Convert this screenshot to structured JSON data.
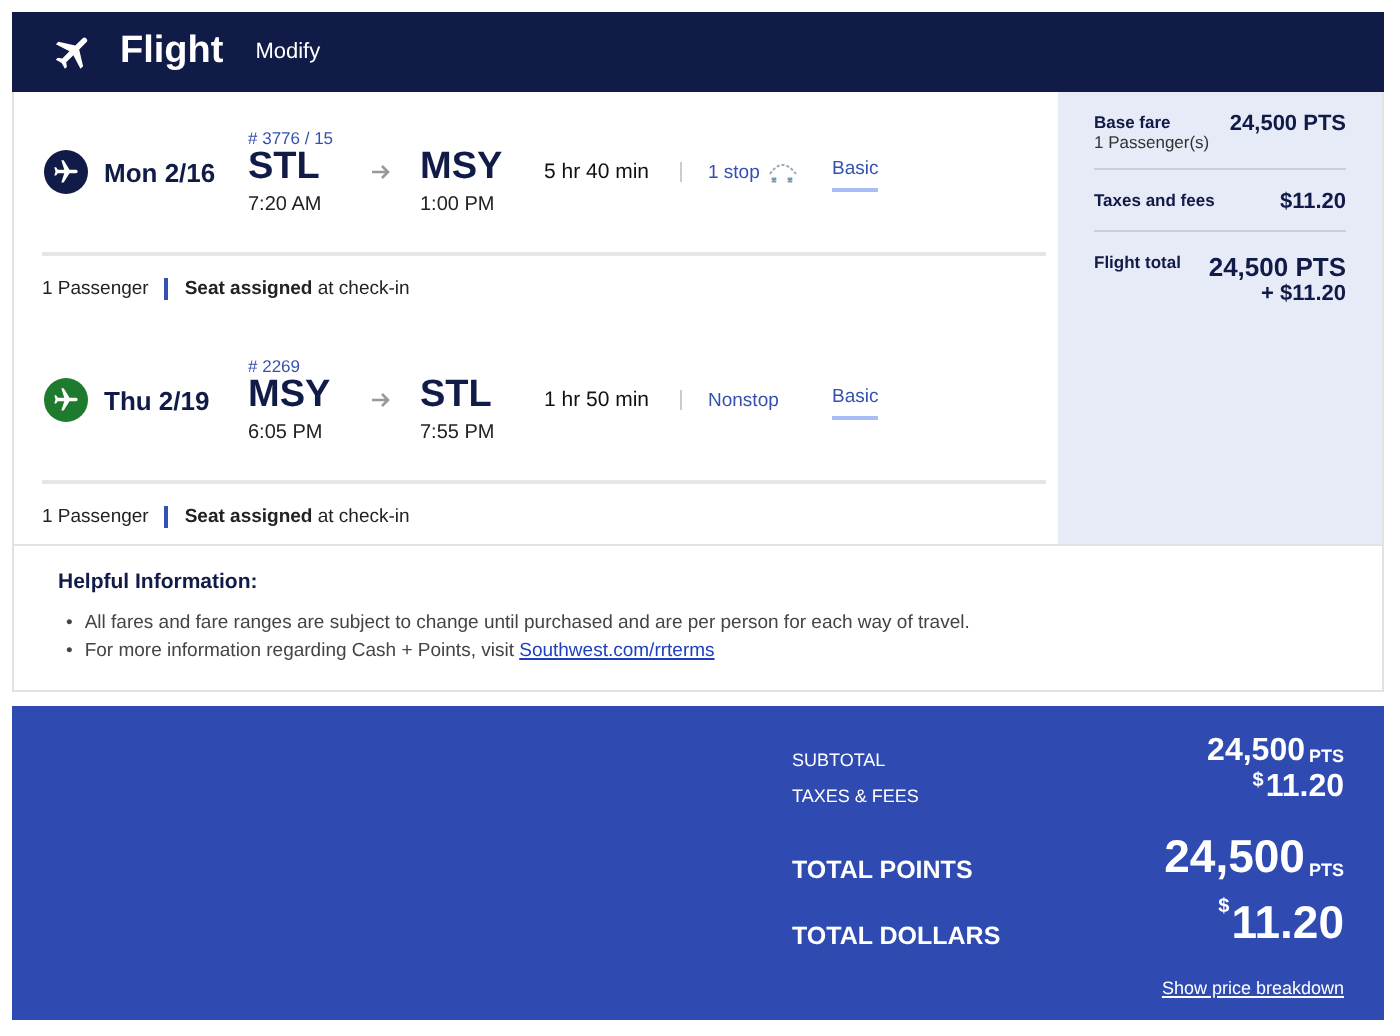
{
  "header": {
    "title": "Flight",
    "action": "Modify"
  },
  "flights": [
    {
      "color": "#111b47",
      "date": "Mon 2/16",
      "number": "# 3776 / 15",
      "from": "STL",
      "depart": "7:20 AM",
      "to": "MSY",
      "arrive": "1:00 PM",
      "duration": "5 hr 40 min",
      "kind": "connecting",
      "stops": "1 stop",
      "fare": "Basic",
      "passengers": "1 Passenger",
      "seat_bold": "Seat assigned",
      "seat_rest": "at check-in"
    },
    {
      "color": "#1e7a2c",
      "date": "Thu 2/19",
      "number": "# 2269",
      "from": "MSY",
      "depart": "6:05 PM",
      "to": "STL",
      "arrive": "7:55 PM",
      "duration": "1 hr 50 min",
      "kind": "nonstop",
      "stops": "Nonstop",
      "fare": "Basic",
      "passengers": "1 Passenger",
      "seat_bold": "Seat assigned",
      "seat_rest": "at check-in"
    }
  ],
  "summary": [
    {
      "label": "Base fare",
      "sub": "1 Passenger(s)",
      "value": "24,500 PTS"
    },
    {
      "label": "Taxes and fees",
      "value": "$11.20"
    },
    {
      "label": "Flight total",
      "value": "24,500 PTS",
      "extra": "+ $11.20"
    }
  ],
  "info": {
    "title": "Helpful Information:",
    "items": [
      {
        "marker": "•",
        "text": "All fares and fare ranges are subject to change until purchased and are per person for each way of travel."
      },
      {
        "marker": "•",
        "text": "For more information regarding Cash + Points, visit",
        "link": "Southwest.com/rrterms"
      }
    ]
  },
  "totals": [
    {
      "kind": "small",
      "label": "SUBTOTAL",
      "amount": "24,500",
      "unit": "PTS"
    },
    {
      "kind": "small",
      "label": "TAXES & FEES",
      "currency": "$",
      "amount": "11.20"
    },
    {
      "kind": "large",
      "label": "TOTAL POINTS",
      "amount": "24,500",
      "unit": "PTS"
    },
    {
      "kind": "large",
      "label": "TOTAL DOLLARS",
      "currency": "$",
      "amount": "11.20"
    }
  ],
  "breakdown_link": "Show price breakdown"
}
